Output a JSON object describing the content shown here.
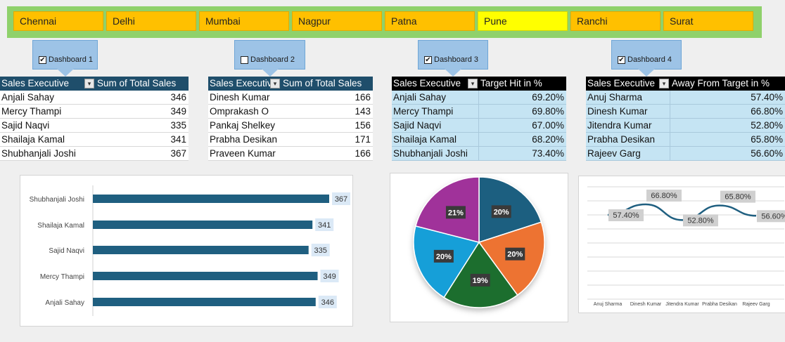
{
  "slicer": {
    "items": [
      "Chennai",
      "Delhi",
      "Mumbai",
      "Nagpur",
      "Patna",
      "Pune",
      "Ranchi",
      "Surat"
    ],
    "selected": "Pune"
  },
  "dashboards": [
    {
      "label": "Dashboard 1",
      "checked": true
    },
    {
      "label": "Dashboard 2",
      "checked": false
    },
    {
      "label": "Dashboard 3",
      "checked": true
    },
    {
      "label": "Dashboard 4",
      "checked": true
    }
  ],
  "tables": [
    {
      "col1": "Sales Executive",
      "col2": "Sum of Total Sales",
      "rows": [
        [
          "Anjali Sahay",
          "346"
        ],
        [
          "Mercy Thampi",
          "349"
        ],
        [
          "Sajid Naqvi",
          "335"
        ],
        [
          "Shailaja Kamal",
          "341"
        ],
        [
          "Shubhanjali Joshi",
          "367"
        ]
      ]
    },
    {
      "col1": "Sales Executive",
      "col2": "Sum of Total Sales",
      "rows": [
        [
          "Dinesh Kumar",
          "166"
        ],
        [
          "Omprakash O",
          "143"
        ],
        [
          "Pankaj Shelkey",
          "156"
        ],
        [
          "Prabha Desikan",
          "171"
        ],
        [
          "Praveen Kumar",
          "166"
        ]
      ]
    },
    {
      "col1": "Sales Executive",
      "col2": "Target Hit in %",
      "rows": [
        [
          "Anjali Sahay",
          "69.20%"
        ],
        [
          "Mercy Thampi",
          "69.80%"
        ],
        [
          "Sajid Naqvi",
          "67.00%"
        ],
        [
          "Shailaja Kamal",
          "68.20%"
        ],
        [
          "Shubhanjali Joshi",
          "73.40%"
        ]
      ]
    },
    {
      "col1": "Sales Executive",
      "col2": "Away From Target in %",
      "rows": [
        [
          "Anuj Sharma",
          "57.40%"
        ],
        [
          "Dinesh Kumar",
          "66.80%"
        ],
        [
          "Jitendra Kumar",
          "52.80%"
        ],
        [
          "Prabha Desikan",
          "65.80%"
        ],
        [
          "Rajeev Garg",
          "56.60%"
        ]
      ]
    }
  ],
  "colors": {
    "slicer_bg": "#8fd16b",
    "slicer_item": "#ffc000",
    "slicer_selected": "#ffff00",
    "header_dark": "#1f4e6b",
    "header_black": "#000000",
    "table_light_blue": "#c5e4f3",
    "bar": "#1f5f80",
    "line": "#1f5f80",
    "pie": [
      "#1f5f80",
      "#ed7330",
      "#1e6e2e",
      "#199fd8",
      "#a0309a"
    ]
  },
  "chart_data": [
    {
      "type": "bar",
      "categories": [
        "Shubhanjali Joshi",
        "Shailaja Kamal",
        "Sajid Naqvi",
        "Mercy Thampi",
        "Anjali Sahay"
      ],
      "values": [
        367,
        341,
        335,
        349,
        346
      ],
      "labels": [
        "367",
        "341",
        "335",
        "349",
        "346"
      ],
      "title": "",
      "xlabel": "",
      "ylabel": ""
    },
    {
      "type": "pie",
      "values": [
        20,
        20,
        19,
        20,
        21
      ],
      "labels": [
        "20%",
        "20%",
        "19%",
        "20%",
        "21%"
      ],
      "title": ""
    },
    {
      "type": "line",
      "categories": [
        "Anuj Sharma",
        "Dinesh Kumar",
        "Jitendra Kumar",
        "Prabha Desikan",
        "Rajeev Garg"
      ],
      "values": [
        57.4,
        66.8,
        52.8,
        65.8,
        56.6
      ],
      "labels": [
        "57.40%",
        "66.80%",
        "52.80%",
        "65.80%",
        "56.60%"
      ],
      "title": "",
      "grid": true
    }
  ]
}
